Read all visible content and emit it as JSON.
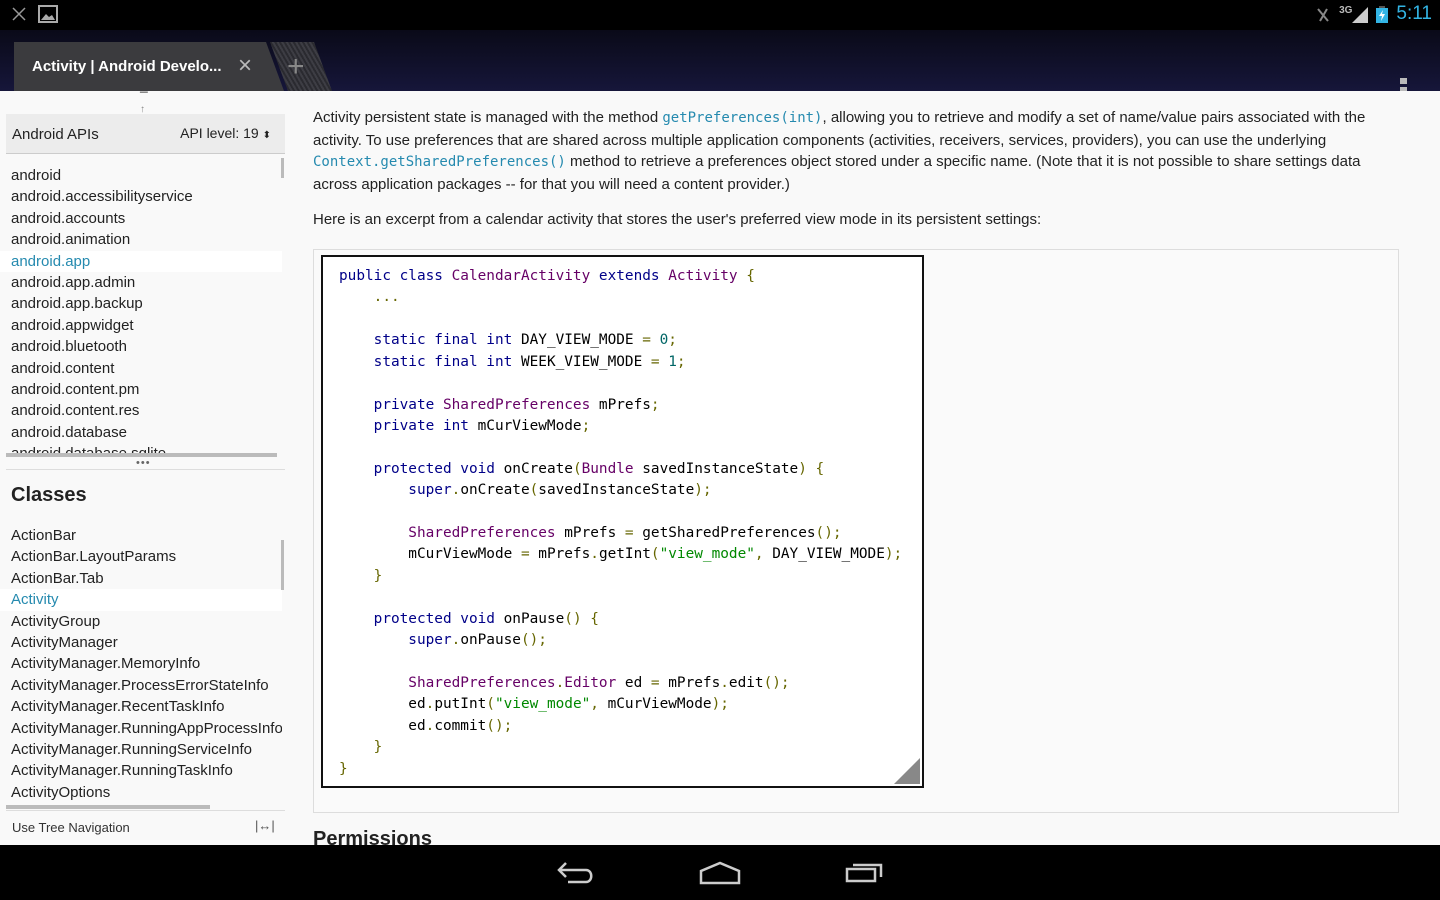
{
  "status_bar": {
    "time": "5:11",
    "network": "3G",
    "icons": [
      "close-icon",
      "gallery-icon",
      "mute-icon",
      "signal-icon",
      "battery-charging-icon"
    ]
  },
  "browser": {
    "tab_title": "Activity | Android Develo...",
    "new_tab": "+",
    "close": "×"
  },
  "sidebar": {
    "api_title": "Android APIs",
    "api_level": "API level: 19",
    "packages": [
      {
        "label": "android"
      },
      {
        "label": "android.accessibilityservice"
      },
      {
        "label": "android.accounts"
      },
      {
        "label": "android.animation"
      },
      {
        "label": "android.app",
        "selected": true
      },
      {
        "label": "android.app.admin"
      },
      {
        "label": "android.app.backup"
      },
      {
        "label": "android.appwidget"
      },
      {
        "label": "android.bluetooth"
      },
      {
        "label": "android.content"
      },
      {
        "label": "android.content.pm"
      },
      {
        "label": "android.content.res"
      },
      {
        "label": "android.database"
      },
      {
        "label": "android.database.sqlite"
      }
    ],
    "dots": "•••",
    "classes_heading": "Classes",
    "classes": [
      {
        "label": "ActionBar"
      },
      {
        "label": "ActionBar.LayoutParams"
      },
      {
        "label": "ActionBar.Tab"
      },
      {
        "label": "Activity",
        "selected": true
      },
      {
        "label": "ActivityGroup"
      },
      {
        "label": "ActivityManager"
      },
      {
        "label": "ActivityManager.MemoryInfo"
      },
      {
        "label": "ActivityManager.ProcessErrorStateInfo"
      },
      {
        "label": "ActivityManager.RecentTaskInfo"
      },
      {
        "label": "ActivityManager.RunningAppProcessInfo"
      },
      {
        "label": "ActivityManager.RunningServiceInfo"
      },
      {
        "label": "ActivityManager.RunningTaskInfo"
      },
      {
        "label": "ActivityOptions"
      }
    ],
    "footer": "Use Tree Navigation"
  },
  "main": {
    "p1": [
      "Activity persistent state is managed with the method ",
      {
        "code": "getPreferences(int)"
      },
      ", allowing you to retrieve and modify a set of name/value pairs associated with the activity. To use preferences that are shared across multiple application components (activities, receivers, services, providers), you can use the underlying ",
      {
        "code": "Context.getSharedPreferences()"
      },
      " method to retrieve a preferences object stored under a specific name. (Note that it is not possible to share settings data across application packages -- for that you will need a content provider.)"
    ],
    "p2": "Here is an excerpt from a calendar activity that stores the user's preferred view mode in its persistent settings:",
    "code": [
      [
        [
          "kwd",
          "public class "
        ],
        [
          "typ",
          "CalendarActivity"
        ],
        [
          "kwd",
          " extends "
        ],
        [
          "typ",
          "Activity"
        ],
        [
          "pun",
          " {"
        ]
      ],
      [
        [
          "pun",
          "    ..."
        ]
      ],
      [],
      [
        [
          "kwd",
          "    static final int "
        ],
        [
          "pln",
          "DAY_VIEW_MODE "
        ],
        [
          "pun",
          "= "
        ],
        [
          "lit",
          "0"
        ],
        [
          "pun",
          ";"
        ]
      ],
      [
        [
          "kwd",
          "    static final int "
        ],
        [
          "pln",
          "WEEK_VIEW_MODE "
        ],
        [
          "pun",
          "= "
        ],
        [
          "lit",
          "1"
        ],
        [
          "pun",
          ";"
        ]
      ],
      [],
      [
        [
          "kwd",
          "    private "
        ],
        [
          "typ",
          "SharedPreferences"
        ],
        [
          "pln",
          " mPrefs"
        ],
        [
          "pun",
          ";"
        ]
      ],
      [
        [
          "kwd",
          "    private int "
        ],
        [
          "pln",
          "mCurViewMode"
        ],
        [
          "pun",
          ";"
        ]
      ],
      [],
      [
        [
          "kwd",
          "    protected void "
        ],
        [
          "pln",
          "onCreate"
        ],
        [
          "pun",
          "("
        ],
        [
          "typ",
          "Bundle"
        ],
        [
          "pln",
          " savedInstanceState"
        ],
        [
          "pun",
          ") {"
        ]
      ],
      [
        [
          "kwd",
          "        super"
        ],
        [
          "pun",
          "."
        ],
        [
          "pln",
          "onCreate"
        ],
        [
          "pun",
          "("
        ],
        [
          "pln",
          "savedInstanceState"
        ],
        [
          "pun",
          ");"
        ]
      ],
      [],
      [
        [
          "typ",
          "        SharedPreferences"
        ],
        [
          "pln",
          " mPrefs "
        ],
        [
          "pun",
          "= "
        ],
        [
          "pln",
          "getSharedPreferences"
        ],
        [
          "pun",
          "();"
        ]
      ],
      [
        [
          "pln",
          "        mCurViewMode "
        ],
        [
          "pun",
          "= "
        ],
        [
          "pln",
          "mPrefs"
        ],
        [
          "pun",
          "."
        ],
        [
          "pln",
          "getInt"
        ],
        [
          "pun",
          "("
        ],
        [
          "str",
          "\"view_mode\""
        ],
        [
          "pun",
          ", "
        ],
        [
          "pln",
          "DAY_VIEW_MODE"
        ],
        [
          "pun",
          ");"
        ]
      ],
      [
        [
          "pun",
          "    }"
        ]
      ],
      [],
      [
        [
          "kwd",
          "    protected void "
        ],
        [
          "pln",
          "onPause"
        ],
        [
          "pun",
          "() {"
        ]
      ],
      [
        [
          "kwd",
          "        super"
        ],
        [
          "pun",
          "."
        ],
        [
          "pln",
          "onPause"
        ],
        [
          "pun",
          "();"
        ]
      ],
      [],
      [
        [
          "typ",
          "        SharedPreferences"
        ],
        [
          "pun",
          "."
        ],
        [
          "typ",
          "Editor"
        ],
        [
          "pln",
          " ed "
        ],
        [
          "pun",
          "= "
        ],
        [
          "pln",
          "mPrefs"
        ],
        [
          "pun",
          "."
        ],
        [
          "pln",
          "edit"
        ],
        [
          "pun",
          "();"
        ]
      ],
      [
        [
          "pln",
          "        ed"
        ],
        [
          "pun",
          "."
        ],
        [
          "pln",
          "putInt"
        ],
        [
          "pun",
          "("
        ],
        [
          "str",
          "\"view_mode\""
        ],
        [
          "pun",
          ", "
        ],
        [
          "pln",
          "mCurViewMode"
        ],
        [
          "pun",
          ");"
        ]
      ],
      [
        [
          "pln",
          "        ed"
        ],
        [
          "pun",
          "."
        ],
        [
          "pln",
          "commit"
        ],
        [
          "pun",
          "();"
        ]
      ],
      [
        [
          "pun",
          "    }"
        ]
      ],
      [
        [
          "pun",
          "}"
        ]
      ]
    ],
    "next_heading": "Permissions"
  },
  "colors": {
    "link": "#258aaf",
    "keyword": "#000088",
    "type": "#660066",
    "punctuation": "#666600",
    "string": "#008800",
    "literal": "#006666",
    "clock": "#33b5e5"
  },
  "nav_bar": {
    "icons": [
      "back-icon",
      "home-icon",
      "recents-icon"
    ]
  }
}
